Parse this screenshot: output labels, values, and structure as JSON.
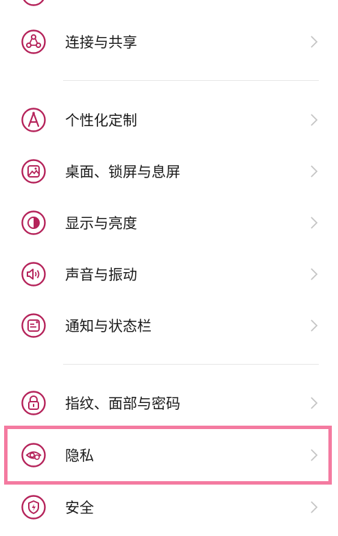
{
  "accent_color": "#b5235a",
  "highlight_color": "#f47aa0",
  "items": [
    {
      "label": "连接与共享",
      "icon": "share-connect-icon"
    },
    {
      "label": "个性化定制",
      "icon": "personalize-icon"
    },
    {
      "label": "桌面、锁屏与息屏",
      "icon": "wallpaper-icon"
    },
    {
      "label": "显示与亮度",
      "icon": "display-brightness-icon"
    },
    {
      "label": "声音与振动",
      "icon": "sound-icon"
    },
    {
      "label": "通知与状态栏",
      "icon": "notification-icon"
    },
    {
      "label": "指纹、面部与密码",
      "icon": "lock-icon"
    },
    {
      "label": "隐私",
      "icon": "privacy-eye-icon"
    },
    {
      "label": "安全",
      "icon": "security-shield-icon"
    }
  ]
}
